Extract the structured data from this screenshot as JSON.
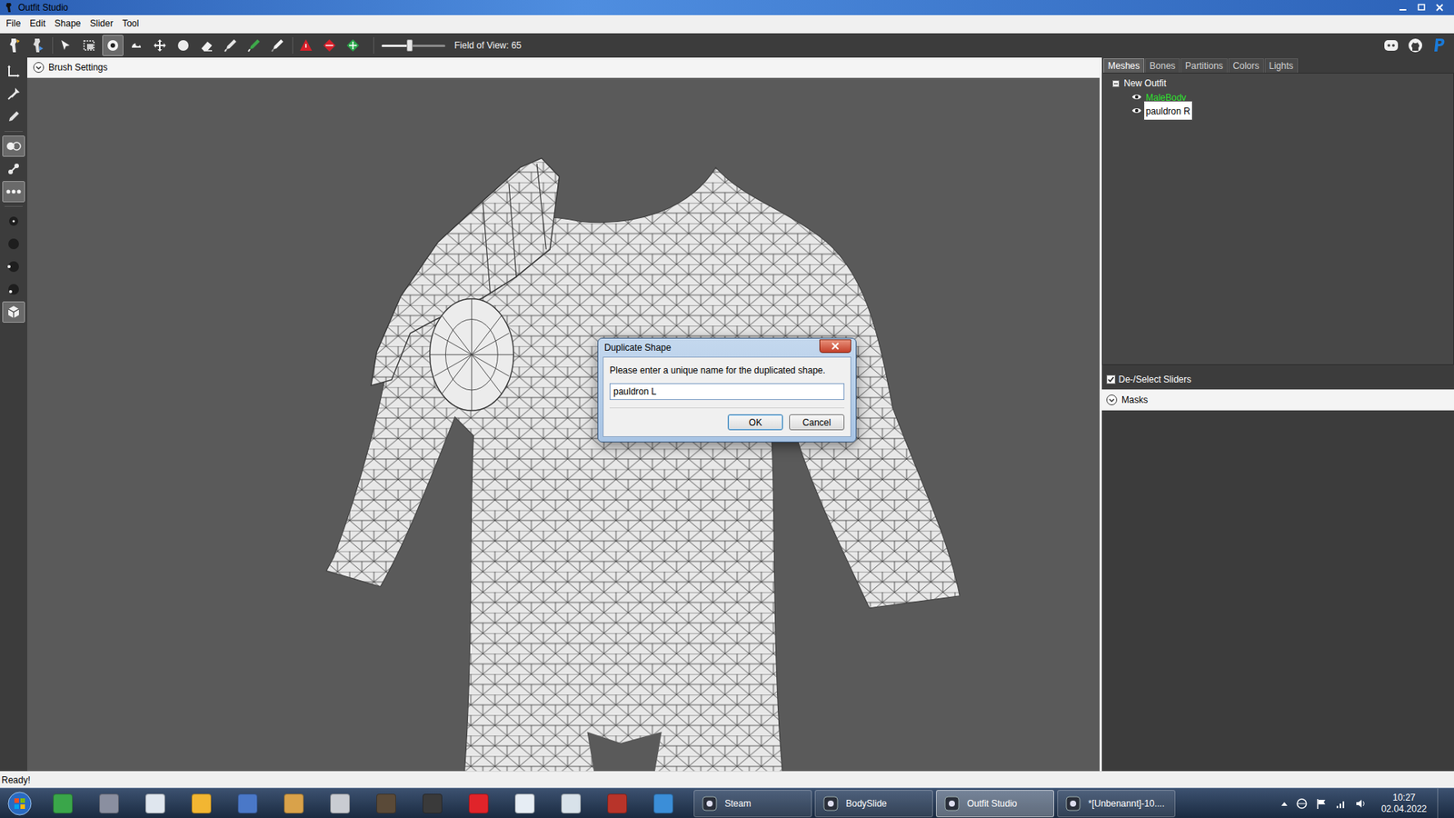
{
  "window": {
    "title": "Outfit Studio"
  },
  "menu": [
    "File",
    "Edit",
    "Shape",
    "Slider",
    "Tool"
  ],
  "toolbar": {
    "tools": [
      {
        "kind": "outfit-studio",
        "selected": false
      },
      {
        "kind": "bodyslide",
        "selected": false
      },
      {
        "kind": "select",
        "selected": false
      },
      {
        "kind": "mask",
        "selected": false
      },
      {
        "kind": "inflate",
        "selected": true
      },
      {
        "kind": "deflate",
        "selected": false
      },
      {
        "kind": "move",
        "selected": false
      },
      {
        "kind": "smooth",
        "selected": false
      },
      {
        "kind": "undiff",
        "selected": false
      },
      {
        "kind": "weight",
        "selected": false
      },
      {
        "kind": "color",
        "selected": false
      },
      {
        "kind": "alpha",
        "selected": false
      },
      {
        "kind": "collapse",
        "selected": false
      },
      {
        "kind": "flip",
        "selected": false
      },
      {
        "kind": "split",
        "selected": false
      }
    ],
    "fov": {
      "label": "Field of View: 65",
      "level": 0.44
    },
    "links": [
      {
        "kind": "discord"
      },
      {
        "kind": "github"
      },
      {
        "kind": "paypal"
      }
    ]
  },
  "side_tools": [
    {
      "kind": "transform",
      "selected": false
    },
    {
      "kind": "pivot",
      "selected": false
    },
    {
      "kind": "pencil",
      "selected": false
    },
    {
      "kind": "mirror",
      "selected": true
    },
    {
      "kind": "connected",
      "selected": false
    },
    {
      "kind": "global",
      "selected": true
    },
    {
      "kind": "dot-small",
      "selected": false
    },
    {
      "kind": "dot-medium",
      "selected": false
    },
    {
      "kind": "dot-large",
      "selected": false
    },
    {
      "kind": "dot-xlarge",
      "selected": false
    },
    {
      "kind": "cube",
      "selected": true
    }
  ],
  "brush_settings": {
    "label": "Brush Settings",
    "expanded": false
  },
  "right_panel": {
    "tabs": [
      {
        "label": "Meshes",
        "selected": true
      },
      {
        "label": "Bones",
        "selected": false
      },
      {
        "label": "Partitions",
        "selected": false
      },
      {
        "label": "Colors",
        "selected": false
      },
      {
        "label": "Lights",
        "selected": false
      }
    ],
    "tree": {
      "root": {
        "label": "New Outfit",
        "expanded": true
      },
      "items": [
        {
          "label": "MaleBody",
          "visible": true,
          "selected": false,
          "reference": true
        },
        {
          "label": "pauldron R",
          "visible": true,
          "selected": true,
          "reference": false
        }
      ]
    },
    "sliders_toggle": {
      "label": "De-/Select Sliders",
      "checked": true
    },
    "masks": {
      "label": "Masks",
      "expanded": false
    }
  },
  "status_bar": "Ready!",
  "dialog": {
    "title": "Duplicate Shape",
    "message": "Please enter a unique name for the duplicated shape.",
    "input_value": "pauldron L",
    "buttons": [
      {
        "label": "OK",
        "selected": true
      },
      {
        "label": "Cancel",
        "selected": false
      }
    ]
  },
  "taskbar": {
    "pinned": [
      {
        "color": "#3aa64a"
      },
      {
        "color": "#8a8fa0"
      },
      {
        "color": "#dfe6ee"
      },
      {
        "color": "#f2b632"
      },
      {
        "color": "#4a78c8"
      },
      {
        "color": "#d9a24a"
      },
      {
        "color": "#c9ccd2"
      },
      {
        "color": "#5a4a38"
      },
      {
        "color": "#3a3a3a"
      },
      {
        "color": "#e0242a"
      },
      {
        "color": "#e6edf4"
      },
      {
        "color": "#d8e2ea"
      },
      {
        "color": "#b8342a"
      },
      {
        "color": "#3b8ed8"
      }
    ],
    "tasks": [
      {
        "label": "Steam",
        "selected": false
      },
      {
        "label": "BodySlide",
        "selected": false
      },
      {
        "label": "Outfit Studio",
        "selected": true
      },
      {
        "label": "*[Unbenannt]-10....",
        "selected": false
      }
    ],
    "clock": {
      "time": "10:27",
      "date": "02.04.2022"
    }
  }
}
